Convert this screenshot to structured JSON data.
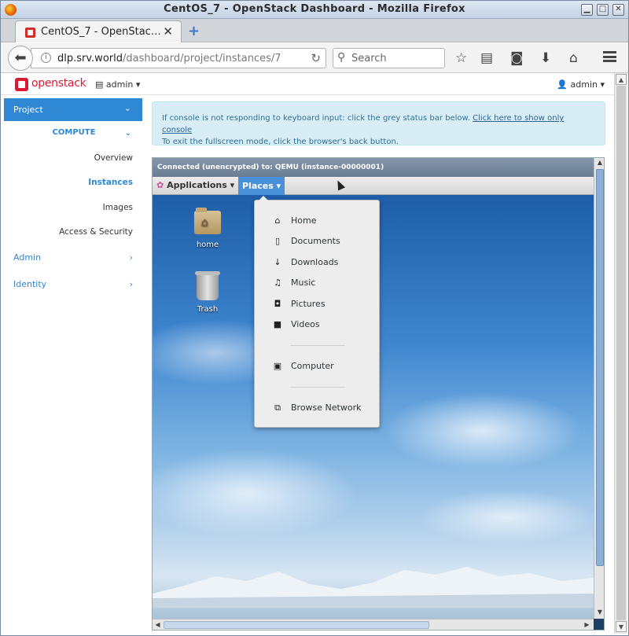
{
  "window": {
    "title": "CentOS_7 - OpenStack Dashboard - Mozilla Firefox",
    "buttons": {
      "minimize": "▁",
      "maximize": "□",
      "close": "✕"
    }
  },
  "tab": {
    "label": "CentOS_7 - OpenStac…",
    "close": "✕",
    "new_tab": "+"
  },
  "nav": {
    "url_host": "dlp.srv.world",
    "url_path": "/dashboard/project/instances/7",
    "search_placeholder": "Search"
  },
  "os_header": {
    "brand": "openstack",
    "project_menu": "admin ▾",
    "user_menu": "admin ▾"
  },
  "sidebar": {
    "project": "Project",
    "compute": "COMPUTE",
    "items": [
      "Overview",
      "Instances",
      "Images",
      "Access & Security"
    ],
    "active_item": "Instances",
    "sections": [
      "Admin",
      "Identity"
    ]
  },
  "banner": {
    "line1": "If console is not responding to keyboard input: click the grey status bar below.",
    "link": "Click here to show only console",
    "line2": "To exit the fullscreen mode, click the browser's back button."
  },
  "console": {
    "status": "Connected (unencrypted) to: QEMU (instance-00000001)",
    "applications": "Applications",
    "places": "Places",
    "desktop_icons": [
      "home",
      "Trash"
    ]
  },
  "places_menu": {
    "items": [
      {
        "label": "Home",
        "icon": "house-icon"
      },
      {
        "label": "Documents",
        "icon": "document-icon"
      },
      {
        "label": "Downloads",
        "icon": "download-icon"
      },
      {
        "label": "Music",
        "icon": "music-icon"
      },
      {
        "label": "Pictures",
        "icon": "camera-icon"
      },
      {
        "label": "Videos",
        "icon": "video-icon"
      },
      {
        "label": "Computer",
        "icon": "computer-icon"
      },
      {
        "label": "Browse Network",
        "icon": "network-icon"
      }
    ]
  },
  "colors": {
    "accent": "#2e88d4",
    "brand_red": "#da1a32",
    "banner_bg": "#d9edf7",
    "places_highlight": "#4a90d9"
  }
}
